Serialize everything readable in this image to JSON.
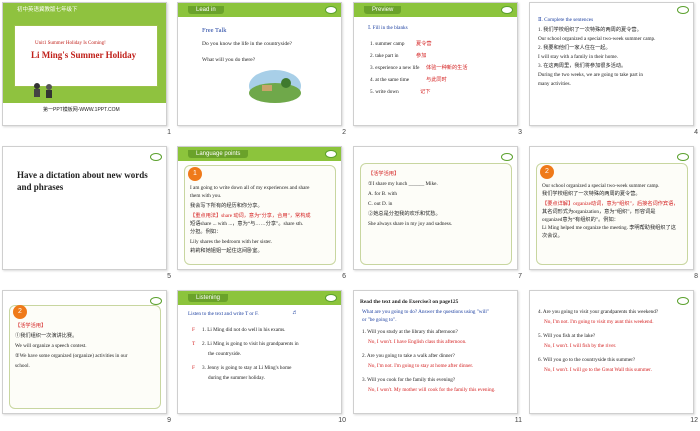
{
  "slides": [
    {
      "number": "1",
      "header": "初中英语冀教版七年级下",
      "unit": "Unit1 Summer Holiday Is Coming!",
      "title": "Li Ming's Summer Holiday",
      "footer": "第一PPT模板网-WWW.1PPT.COM"
    },
    {
      "number": "2",
      "tab": "Lead  in",
      "heading": "Free Talk",
      "lines": [
        "Do you know the life in the countryside?",
        "What will you do there?"
      ]
    },
    {
      "number": "3",
      "tab": "Preview",
      "section": "Ⅰ. Fill in the blanks",
      "items": [
        {
          "en": "1. summer camp",
          "cn": "夏令营"
        },
        {
          "en": "2. take part in",
          "cn": "参加"
        },
        {
          "en": "3. experience a new life",
          "cn": "体验一种新的生活"
        },
        {
          "en": "4. at the same time",
          "cn": "与此同时"
        },
        {
          "en": "5. write down",
          "cn": "记下"
        }
      ]
    },
    {
      "number": "4",
      "section": "Ⅱ. Complete the sentences",
      "lines": [
        "1. 我们学校组织了一次特殊的两周的夏令营。",
        "Our school organized a special two-week summer camp.",
        "2. 我要和他们一家人住在一起。",
        "I will stay with a family in their home.",
        "3. 在这两周里，我们将参加很多活动。",
        "During the two weeks, we are going to take part in",
        "many activities."
      ]
    },
    {
      "number": "5",
      "title": "Have a dictation about new words and phrases"
    },
    {
      "number": "6",
      "tab": "Language points",
      "badge": "1",
      "lines": [
        "I am going to write down all of my experiences and share",
        "them with you.",
        "我会写下所有的经历和你分享。",
        "【重点用法】share 动词，意为“分享，合用”，常构成",
        "短语share ... with ...，意为“与……分享”。share sth.",
        "分担。例如：",
        "Lily shares the bedroom with her sister.",
        "莉莉和她姐姐一起住这间卧室。"
      ]
    },
    {
      "number": "7",
      "lines": [
        "【活学活用】",
        "①I share my lunch ______ Mike.",
        "A. for            B. with",
        "C. out            D. in",
        "②她总是分担我的欢乐和忧愁。",
        "She always share in my joy and sadness."
      ]
    },
    {
      "number": "8",
      "badge": "2",
      "lines": [
        "Our school organized a special two-week summer camp.",
        "我们学校组织了一次特殊的两周的夏令营。",
        "【要点详解】organize动词，意为“组织”，后接名词作宾语，",
        "其名词形式为organization，意为“组织”，形容词是",
        "organized意为“有组织的”。例如：",
        "Li Ming helped me organize the meeting. 李明帮助我组织了这",
        "次会议。"
      ]
    },
    {
      "number": "9",
      "badge": "2",
      "lines": [
        "【活学活用】",
        "①我们组织一次演讲比赛。",
        "We will organize a speech contest.",
        "②We have some organized (organize) activities in our",
        "school."
      ]
    },
    {
      "number": "10",
      "tab": "Listening",
      "instruction": "Listen to the text and write T or F.",
      "items": [
        {
          "mark": "F",
          "text": "1. Li Ming did not do well in his exams."
        },
        {
          "mark": "T",
          "text": "2. Li Ming is going to visit his grandparents in"
        },
        {
          "mark": "",
          "text": "the countryside."
        },
        {
          "mark": "F",
          "text": "3. Jenny is going to stay at Li Ming's home"
        },
        {
          "mark": "",
          "text": "during the summer holiday."
        }
      ]
    },
    {
      "number": "11",
      "title": "Read the text and do Exercise3 on page125",
      "intro": [
        "What are you going to do? Answer the questions using \"will\"",
        "or \"be going to\"."
      ],
      "qa": [
        {
          "q": "1. Will you study at the library this afternoon?",
          "a": "No, I won't. I have English class this afternoon."
        },
        {
          "q": "2. Are you going to take a walk after dinner?",
          "a": "No, I'm not. I'm going to stay at home after dinner."
        },
        {
          "q": "3. Will you cook for the family this evening?",
          "a": "No, I won't. My mother will cook for the family this evening."
        }
      ]
    },
    {
      "number": "12",
      "qa": [
        {
          "q": "4. Are you going to visit your grandparents this weekend?",
          "a": "No, I'm not. I'm going to visit my aunt this weekend."
        },
        {
          "q": "5. Will you fish at the lake?",
          "a": "No, I won't. I will fish by the river."
        },
        {
          "q": "6. Will you go to the countryside this summer?",
          "a": "No, I won't. I will go to the Great Wall this summer."
        }
      ]
    }
  ]
}
